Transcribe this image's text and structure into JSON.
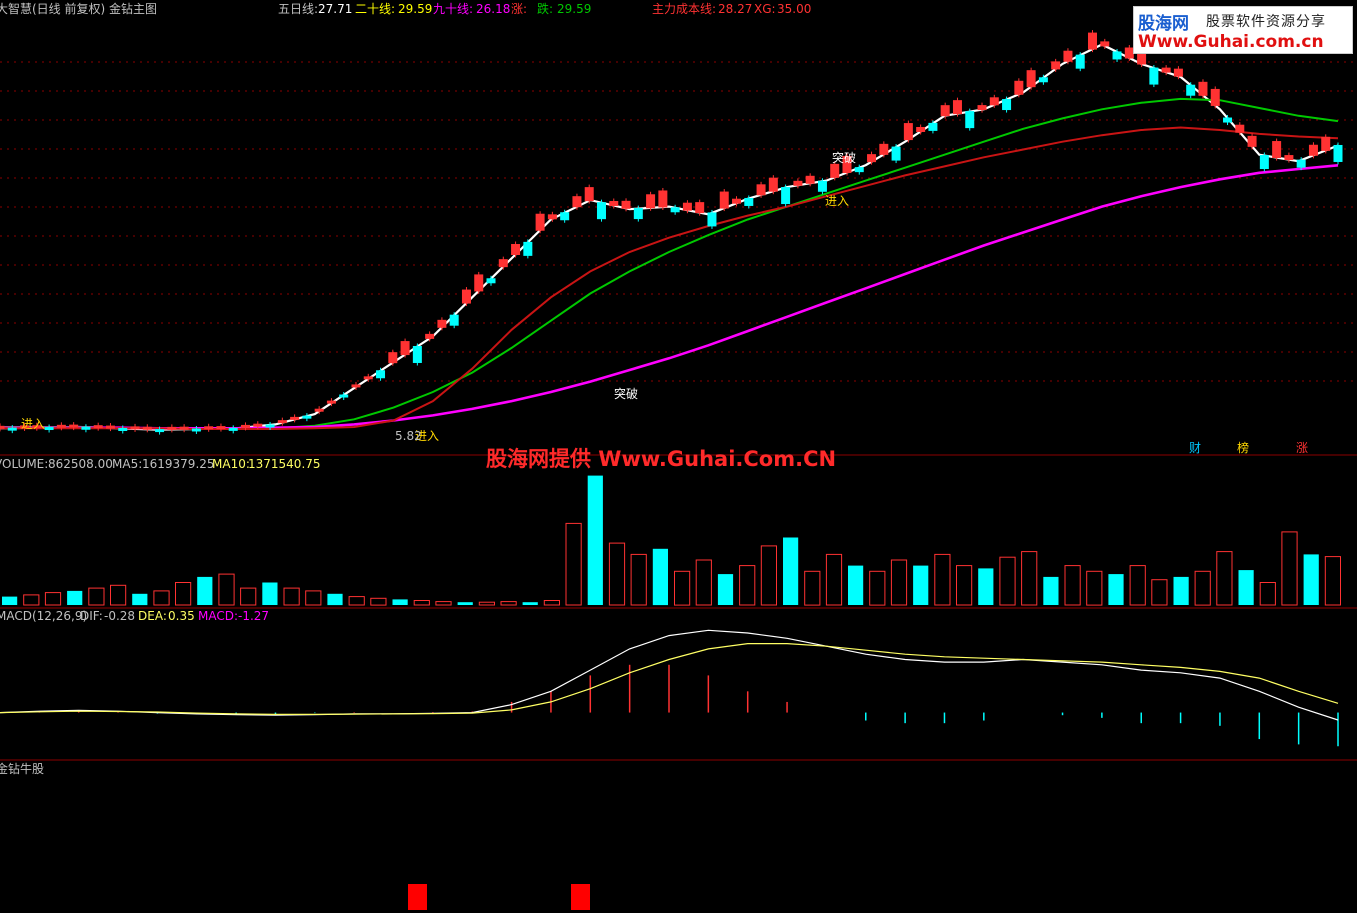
{
  "header": {
    "title": "大智慧(日线 前复权) 金钻主图",
    "ma5_label": "五日线:",
    "ma5_value": "27.71",
    "ma20_label": "二十线:",
    "ma20_value": "29.59",
    "ma90_label": "九十线:",
    "ma90_value": "26.18",
    "up_label": "涨:",
    "up_value": "",
    "down_label": "跌:",
    "down_value": "29.59",
    "cost_label": "主力成本线:",
    "cost_value": "28.27",
    "xg_label": "XG:",
    "xg_value": "35.00"
  },
  "annotations": {
    "enter": "进入",
    "breakthrough": "突破",
    "low_price": "5.82",
    "badge_cai": "财",
    "badge_bang": "榜",
    "badge_zhang": "涨"
  },
  "volume_header": {
    "name": "VOLUME:",
    "value": "862508.00",
    "ma5_label": "MA5:",
    "ma5_value": "1619379.25",
    "ma10_label": "MA10:",
    "ma10_value": "1371540.75"
  },
  "macd_header": {
    "name": "MACD(12,26,9)",
    "dif_label": "DIF:",
    "dif_value": "-0.28",
    "dea_label": "DEA:",
    "dea_value": "0.35",
    "macd_label": "MACD:",
    "macd_value": "-1.27"
  },
  "bottom_panel": {
    "title": "金钻牛股"
  },
  "watermark": {
    "brand": "股海网",
    "slogan": "股票软件资源分享",
    "url": "Www.Guhai.com.cn",
    "center": "股海网提供 Www.Guhai.Com.CN"
  },
  "colors": {
    "up": "#ff3232",
    "down": "#00ffff",
    "ma5": "#ffffff",
    "ma20": "#00c800",
    "ma90": "#ff00ff",
    "cost": "#c81414",
    "dea": "#ffff64",
    "grid": "#8b0000"
  },
  "chart_data": [
    {
      "type": "line",
      "title": "金钻主图",
      "series": [
        {
          "name": "五日线",
          "values": [
            5.9,
            5.95,
            6.0,
            5.9,
            5.8,
            5.85,
            5.9,
            6.2,
            7.0,
            9.0,
            11.0,
            13.0,
            16.0,
            19.0,
            22.0,
            23.5,
            22.8,
            23.0,
            22.4,
            23.6,
            24.5,
            25.0,
            26.2,
            28.0,
            30.0,
            30.5,
            31.8,
            34.0,
            35.5,
            34.0,
            33.0,
            30.5,
            27.0,
            26.5,
            27.71
          ]
        },
        {
          "name": "二十线",
          "values": [
            6.0,
            6.0,
            6.0,
            5.95,
            5.9,
            5.85,
            5.85,
            5.9,
            6.1,
            6.6,
            7.5,
            8.7,
            10.2,
            12.1,
            14.2,
            16.3,
            18.0,
            19.5,
            20.8,
            22.0,
            23.0,
            24.0,
            25.0,
            26.0,
            27.0,
            28.0,
            29.0,
            29.8,
            30.5,
            31.0,
            31.3,
            31.2,
            30.6,
            30.0,
            29.59
          ]
        },
        {
          "name": "九十线",
          "values": [
            5.95,
            5.95,
            5.95,
            5.95,
            5.9,
            5.9,
            5.9,
            5.95,
            6.0,
            6.2,
            6.5,
            6.9,
            7.4,
            8.0,
            8.7,
            9.5,
            10.4,
            11.3,
            12.3,
            13.4,
            14.5,
            15.6,
            16.7,
            17.8,
            18.9,
            20.0,
            21.0,
            22.0,
            23.0,
            23.8,
            24.5,
            25.1,
            25.6,
            25.9,
            26.18
          ]
        },
        {
          "name": "主力成本线",
          "values": [
            5.9,
            5.9,
            5.9,
            5.9,
            5.9,
            5.85,
            5.85,
            5.85,
            5.9,
            6.0,
            6.5,
            8.0,
            10.5,
            13.5,
            16.0,
            18.0,
            19.5,
            20.6,
            21.5,
            22.3,
            23.0,
            23.8,
            24.6,
            25.4,
            26.1,
            26.8,
            27.4,
            28.0,
            28.5,
            28.9,
            29.1,
            28.9,
            28.6,
            28.4,
            28.27
          ]
        }
      ],
      "ylim": [
        5,
        37
      ]
    },
    {
      "type": "bar",
      "title": "VOLUME",
      "values": [
        0.15,
        0.18,
        0.22,
        0.25,
        0.3,
        0.35,
        0.2,
        0.25,
        0.4,
        0.5,
        0.55,
        0.3,
        0.4,
        0.3,
        0.25,
        0.2,
        0.15,
        0.12,
        0.1,
        0.08,
        0.06,
        0.05,
        0.05,
        0.06,
        0.05,
        0.08,
        1.45,
        2.3,
        1.1,
        0.9,
        1.0,
        0.6,
        0.8,
        0.55,
        0.7,
        1.05,
        1.2,
        0.6,
        0.9,
        0.7,
        0.6,
        0.8,
        0.7,
        0.9,
        0.7,
        0.65,
        0.85,
        0.95,
        0.5,
        0.7,
        0.6,
        0.55,
        0.7,
        0.45,
        0.5,
        0.6,
        0.95,
        0.62,
        0.4,
        1.3,
        0.9,
        0.86
      ],
      "ylim": [
        0,
        2.4
      ]
    },
    {
      "type": "line",
      "title": "MACD(12,26,9)",
      "series": [
        {
          "name": "DIF",
          "values": [
            0.0,
            0.05,
            0.08,
            0.05,
            0.0,
            -0.05,
            -0.08,
            -0.1,
            -0.08,
            -0.05,
            -0.05,
            -0.03,
            0.0,
            0.3,
            0.8,
            1.6,
            2.4,
            2.9,
            3.1,
            3.0,
            2.8,
            2.5,
            2.2,
            2.0,
            1.9,
            1.9,
            2.0,
            1.9,
            1.8,
            1.6,
            1.5,
            1.3,
            0.8,
            0.2,
            -0.28
          ]
        },
        {
          "name": "DEA",
          "values": [
            0.0,
            0.03,
            0.05,
            0.04,
            0.02,
            -0.02,
            -0.05,
            -0.07,
            -0.07,
            -0.06,
            -0.05,
            -0.04,
            -0.02,
            0.1,
            0.4,
            0.9,
            1.5,
            2.0,
            2.4,
            2.6,
            2.6,
            2.5,
            2.35,
            2.2,
            2.1,
            2.05,
            2.0,
            1.95,
            1.9,
            1.8,
            1.7,
            1.55,
            1.3,
            0.8,
            0.35
          ]
        }
      ],
      "histogram": [
        0.0,
        0.04,
        0.06,
        0.02,
        -0.04,
        -0.06,
        -0.06,
        -0.06,
        -0.02,
        0.02,
        0.0,
        0.02,
        0.04,
        0.4,
        0.8,
        1.4,
        1.8,
        1.8,
        1.4,
        0.8,
        0.4,
        0.0,
        -0.3,
        -0.4,
        -0.4,
        -0.3,
        0.0,
        -0.1,
        -0.2,
        -0.4,
        -0.4,
        -0.5,
        -1.0,
        -1.2,
        -1.27
      ],
      "ylim": [
        -1.6,
        3.3
      ]
    }
  ]
}
